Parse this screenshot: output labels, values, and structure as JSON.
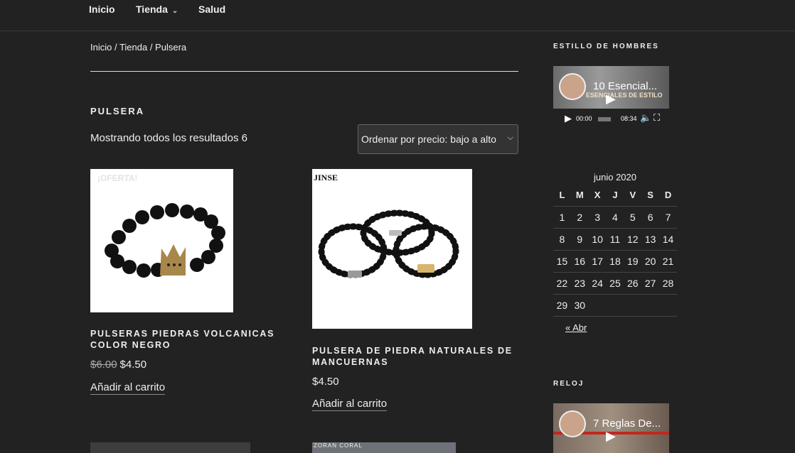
{
  "nav": {
    "items": [
      {
        "label": "Inicio"
      },
      {
        "label": "Tienda"
      },
      {
        "label": "Salud"
      }
    ]
  },
  "breadcrumb": "Inicio / Tienda / Pulsera",
  "page": {
    "title": "PULSERA",
    "result_count": "Mostrando todos los resultados 6",
    "sort_selected": "Ordenar por precio: bajo a alto"
  },
  "products": [
    {
      "badge": "¡OFERTA!",
      "title": "PULSERAS PIEDRAS VOLCANICAS COLOR NEGRO",
      "old_price": "$6.00",
      "price": "$4.50",
      "cart": "Añadir al carrito"
    },
    {
      "brand_mark": "JINSE",
      "title": "PULSERA DE PIEDRA NATURALES DE MANCUERNAS",
      "price": "$4.50",
      "cart": "Añadir al carrito"
    },
    {},
    {
      "brand_mark": "ZORAN CORAL"
    }
  ],
  "sidebar": {
    "widget1_title": "ESTILLO DE HOMBRES",
    "video1": {
      "title": "10 Esencial...",
      "overlay_text": "ESENCIALES DE ESTILO",
      "time_current": "00:00",
      "time_total": "08:34"
    },
    "calendar": {
      "caption": "junio 2020",
      "days": [
        "L",
        "M",
        "X",
        "J",
        "V",
        "S",
        "D"
      ],
      "weeks": [
        [
          "1",
          "2",
          "3",
          "4",
          "5",
          "6",
          "7"
        ],
        [
          "8",
          "9",
          "10",
          "11",
          "12",
          "13",
          "14"
        ],
        [
          "15",
          "16",
          "17",
          "18",
          "19",
          "20",
          "21"
        ],
        [
          "22",
          "23",
          "24",
          "25",
          "26",
          "27",
          "28"
        ],
        [
          "29",
          "30",
          "",
          "",
          "",
          "",
          ""
        ]
      ],
      "prev": "« Abr"
    },
    "widget2_title": "RELOJ",
    "video2": {
      "title": "7 Reglas De..."
    }
  },
  "colors": {
    "bg": "#222222",
    "text": "#eeeeee"
  }
}
